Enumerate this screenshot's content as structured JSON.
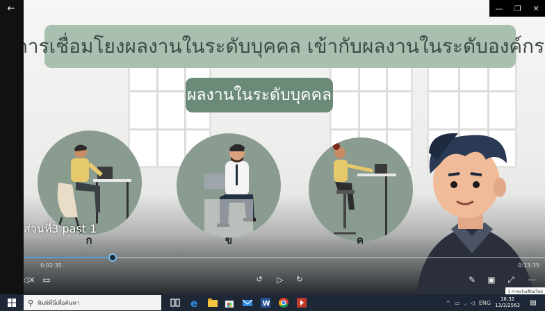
{
  "video": {
    "title_banner": "การเชื่อมโยงผลงานในระดับบุคคล เข้ากับผลงานในระดับองค์กร",
    "sub_banner": "ผลงานในระดับบุคคล",
    "circle_labels": [
      "ก",
      "ข",
      "ค"
    ],
    "caption": "ส่วนที่3 past 1",
    "progress_fraction": 0.17
  },
  "player": {
    "time_current": "0:02:35",
    "time_total": "0:13:35"
  },
  "window_controls": {
    "minimize": "—",
    "maximize": "❐",
    "close": "✕"
  },
  "toast": "1 การแจ้งเตือนใหม่",
  "taskbar": {
    "search_placeholder": "พิมพ์ที่นี่เพื่อค้นหา",
    "language": "ENG",
    "time": "16:32",
    "date": "13/3/2563"
  },
  "colors": {
    "title_banner": "#a9bfb0",
    "sub_banner": "#6b8a78",
    "circle": "#8a9c90",
    "seek_accent": "#4fa3e0",
    "taskbar": "#1d2736"
  },
  "icons": [
    "back-arrow-icon",
    "volume-icon",
    "subtitles-icon",
    "rewind-10-icon",
    "play-icon",
    "forward-30-icon",
    "pen-icon",
    "miniplayer-icon",
    "fullscreen-icon",
    "more-icon",
    "windows-start-icon",
    "search-icon",
    "task-view-icon",
    "edge-icon",
    "file-explorer-icon",
    "store-icon",
    "mail-icon",
    "word-icon",
    "chrome-icon",
    "media-player-icon"
  ]
}
